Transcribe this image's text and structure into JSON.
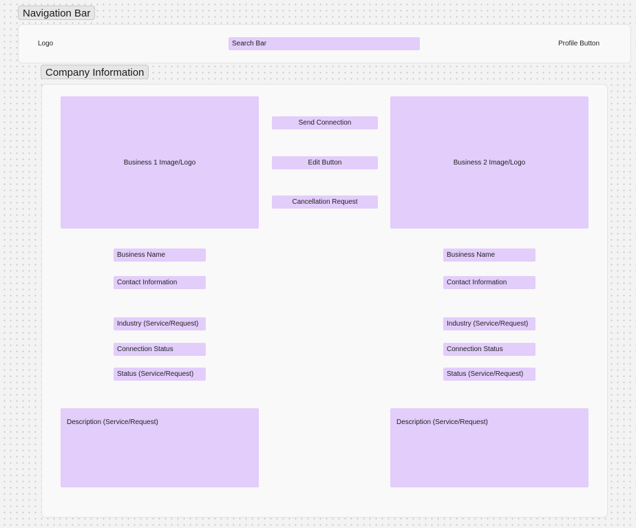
{
  "frames": {
    "nav_title": "Navigation Bar",
    "company_title": "Company Information"
  },
  "nav": {
    "logo": "Logo",
    "search": "Search Bar",
    "profile": "Profile Button"
  },
  "actions": {
    "send_connection": "Send Connection",
    "edit": "Edit Button",
    "cancellation": "Cancellation Request"
  },
  "business1": {
    "image": "Business 1 Image/Logo",
    "name": "Business Name",
    "contact": "Contact Information",
    "industry": "Industry (Service/Request)",
    "connection_status": "Connection Status",
    "status": "Status (Service/Request)",
    "description": "Description (Service/Request)"
  },
  "business2": {
    "image": "Business 2 Image/Logo",
    "name": "Business Name",
    "contact": "Contact Information",
    "industry": "Industry (Service/Request)",
    "connection_status": "Connection Status",
    "status": "Status (Service/Request)",
    "description": "Description (Service/Request)"
  }
}
